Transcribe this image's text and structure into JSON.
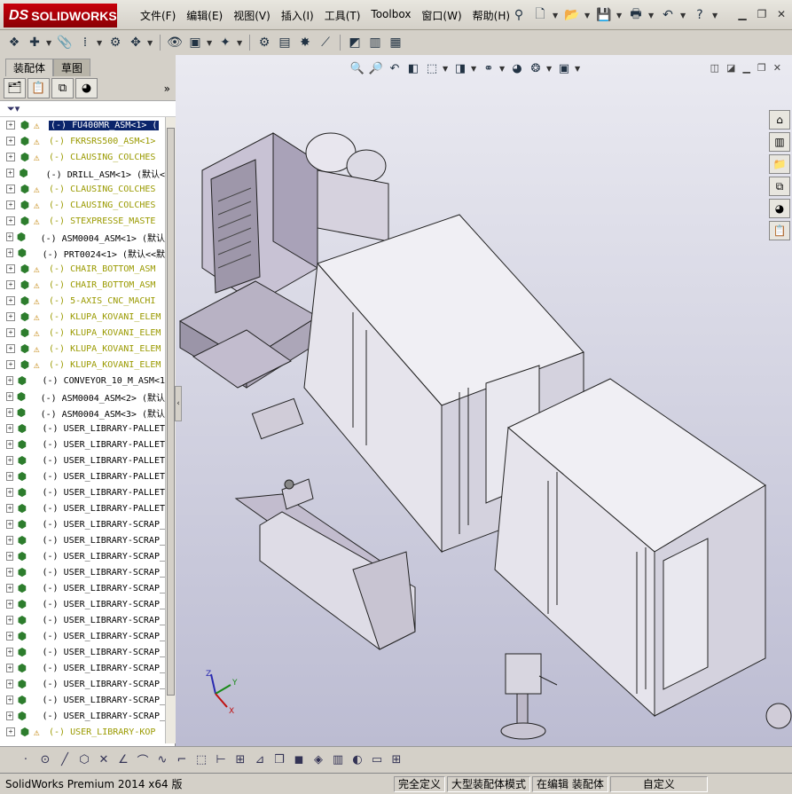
{
  "titlebar": {
    "logo_ds": "DS",
    "logo_text": "SOLIDWORKS",
    "menus": [
      "文件(F)",
      "编辑(E)",
      "视图(V)",
      "插入(I)",
      "工具(T)",
      "Toolbox",
      "窗口(W)",
      "帮助(H)"
    ]
  },
  "panel": {
    "tabs": [
      "装配体",
      "草图"
    ],
    "more": "»"
  },
  "tree": [
    {
      "label": "(-) FU400MR_ASM<1> (",
      "warn": true,
      "style": "selected"
    },
    {
      "label": "(-) FKRSRS500_ASM<1>",
      "warn": true,
      "style": "yellow"
    },
    {
      "label": "(-) CLAUSING_COLCHES",
      "warn": true,
      "style": "yellow"
    },
    {
      "label": "(-) DRILL_ASM<1> (默认<",
      "warn": false,
      "style": "normal"
    },
    {
      "label": "(-) CLAUSING_COLCHES",
      "warn": true,
      "style": "yellow"
    },
    {
      "label": "(-) CLAUSING_COLCHES",
      "warn": true,
      "style": "yellow"
    },
    {
      "label": "(-) STEXPRESSE_MASTE",
      "warn": true,
      "style": "yellow"
    },
    {
      "label": "(-) ASM0004_ASM<1> (默认",
      "warn": false,
      "style": "normal"
    },
    {
      "label": "(-) PRT0024<1> (默认<<默",
      "warn": false,
      "style": "normal"
    },
    {
      "label": "(-) CHAIR_BOTTOM_ASM",
      "warn": true,
      "style": "yellow"
    },
    {
      "label": "(-) CHAIR_BOTTOM_ASM",
      "warn": true,
      "style": "yellow"
    },
    {
      "label": "(-) 5-AXIS_CNC_MACHI",
      "warn": true,
      "style": "yellow"
    },
    {
      "label": "(-) KLUPA_KOVANI_ELEM",
      "warn": true,
      "style": "yellow"
    },
    {
      "label": "(-) KLUPA_KOVANI_ELEM",
      "warn": true,
      "style": "yellow"
    },
    {
      "label": "(-) KLUPA_KOVANI_ELEM",
      "warn": true,
      "style": "yellow"
    },
    {
      "label": "(-) KLUPA_KOVANI_ELEM",
      "warn": true,
      "style": "yellow"
    },
    {
      "label": "(-) CONVEYOR_10_M_ASM<1",
      "warn": false,
      "style": "normal"
    },
    {
      "label": "(-) ASM0004_ASM<2> (默认",
      "warn": false,
      "style": "normal"
    },
    {
      "label": "(-) ASM0004_ASM<3> (默认",
      "warn": false,
      "style": "normal"
    },
    {
      "label": "(-) USER_LIBRARY-PALLET",
      "warn": false,
      "style": "normal"
    },
    {
      "label": "(-) USER_LIBRARY-PALLET",
      "warn": false,
      "style": "normal"
    },
    {
      "label": "(-) USER_LIBRARY-PALLET",
      "warn": false,
      "style": "normal"
    },
    {
      "label": "(-) USER_LIBRARY-PALLET",
      "warn": false,
      "style": "normal"
    },
    {
      "label": "(-) USER_LIBRARY-PALLET",
      "warn": false,
      "style": "normal"
    },
    {
      "label": "(-) USER_LIBRARY-PALLET",
      "warn": false,
      "style": "normal"
    },
    {
      "label": "(-) USER_LIBRARY-SCRAP_",
      "warn": false,
      "style": "normal"
    },
    {
      "label": "(-) USER_LIBRARY-SCRAP_",
      "warn": false,
      "style": "normal"
    },
    {
      "label": "(-) USER_LIBRARY-SCRAP_",
      "warn": false,
      "style": "normal"
    },
    {
      "label": "(-) USER_LIBRARY-SCRAP_",
      "warn": false,
      "style": "normal"
    },
    {
      "label": "(-) USER_LIBRARY-SCRAP_",
      "warn": false,
      "style": "normal"
    },
    {
      "label": "(-) USER_LIBRARY-SCRAP_",
      "warn": false,
      "style": "normal"
    },
    {
      "label": "(-) USER_LIBRARY-SCRAP_",
      "warn": false,
      "style": "normal"
    },
    {
      "label": "(-) USER_LIBRARY-SCRAP_",
      "warn": false,
      "style": "normal"
    },
    {
      "label": "(-) USER_LIBRARY-SCRAP_",
      "warn": false,
      "style": "normal"
    },
    {
      "label": "(-) USER_LIBRARY-SCRAP_",
      "warn": false,
      "style": "normal"
    },
    {
      "label": "(-) USER_LIBRARY-SCRAP_",
      "warn": false,
      "style": "normal"
    },
    {
      "label": "(-) USER_LIBRARY-SCRAP_",
      "warn": false,
      "style": "normal"
    },
    {
      "label": "(-) USER_LIBRARY-SCRAP_",
      "warn": false,
      "style": "normal"
    },
    {
      "label": "(-) USER_LIBRARY-KOP",
      "warn": true,
      "style": "yellow"
    }
  ],
  "triad": {
    "x": "X",
    "y": "Y",
    "z": "Z"
  },
  "status": {
    "app": "SolidWorks Premium 2014 x64 版",
    "fully_defined": "完全定义",
    "large_assembly": "大型装配体模式",
    "editing": "在编辑 装配体",
    "custom": "自定义"
  },
  "colors": {
    "accent": "#c8000a",
    "selection": "#0a246a",
    "viewport_top": "#eaeaf1",
    "viewport_bottom": "#bcbcd2",
    "warning": "#c08000"
  }
}
